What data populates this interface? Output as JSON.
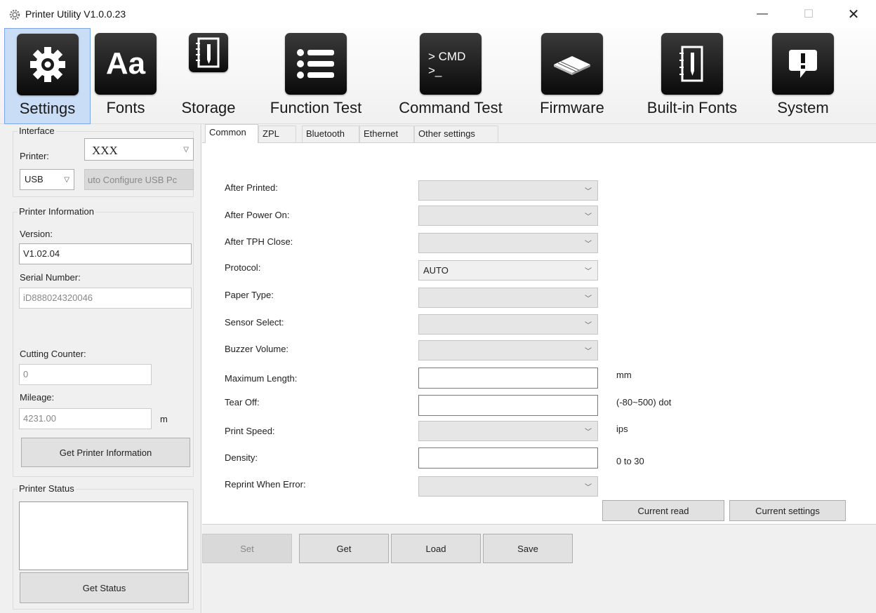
{
  "window": {
    "title": "Printer Utility  V1.0.0.23",
    "minimize": "—",
    "maximize": "☐",
    "close": "✕"
  },
  "toolbar": {
    "settings": "Settings",
    "fonts": "Fonts",
    "fonts_icon_text": "Aa",
    "storage": "Storage",
    "function_test": "Function Test",
    "command_test": "Command Test",
    "command_icon_line1": "> CMD",
    "command_icon_line2": ">_",
    "firmware": "Firmware",
    "builtin_fonts": "Built-in Fonts",
    "system": "System"
  },
  "interface": {
    "group_label": "Interface",
    "printer_label": "Printer:",
    "printer_value": "XXX",
    "port_value": "USB",
    "auto_config_button": "uto Configure USB Pc"
  },
  "printer_info": {
    "group_label": "Printer Information",
    "version_label": "Version:",
    "version_value": "V1.02.04",
    "serial_label": "Serial Number:",
    "serial_value": "iD888024320046",
    "cutting_label": "Cutting Counter:",
    "cutting_value": "0",
    "mileage_label": "Mileage:",
    "mileage_value": "4231.00",
    "mileage_unit": "m",
    "get_info_button": "Get Printer Information"
  },
  "printer_status": {
    "group_label": "Printer Status",
    "get_status_button": "Get Status"
  },
  "tabs": [
    "Common",
    "ZPL",
    "Bluetooth",
    "Ethernet",
    "Other settings"
  ],
  "form": {
    "after_printed": "After Printed:",
    "after_power_on": "After Power On:",
    "after_tph_close": "After TPH Close:",
    "protocol": "Protocol:",
    "protocol_value": "AUTO",
    "paper_type": "Paper Type:",
    "sensor_select": "Sensor Select:",
    "buzzer_volume": "Buzzer Volume:",
    "maximum_length": "Maximum Length:",
    "maximum_length_unit": "mm",
    "tear_off": "Tear Off:",
    "tear_off_unit": "(-80~500) dot",
    "print_speed": "Print Speed:",
    "print_speed_unit": "ips",
    "density": "Density:",
    "density_unit": "0 to 30",
    "reprint_when_error": "Reprint When Error:",
    "current_read_button": "Current read",
    "current_settings_button": "Current settings"
  },
  "actions": {
    "set": "Set",
    "get": "Get",
    "load": "Load",
    "save": "Save"
  }
}
